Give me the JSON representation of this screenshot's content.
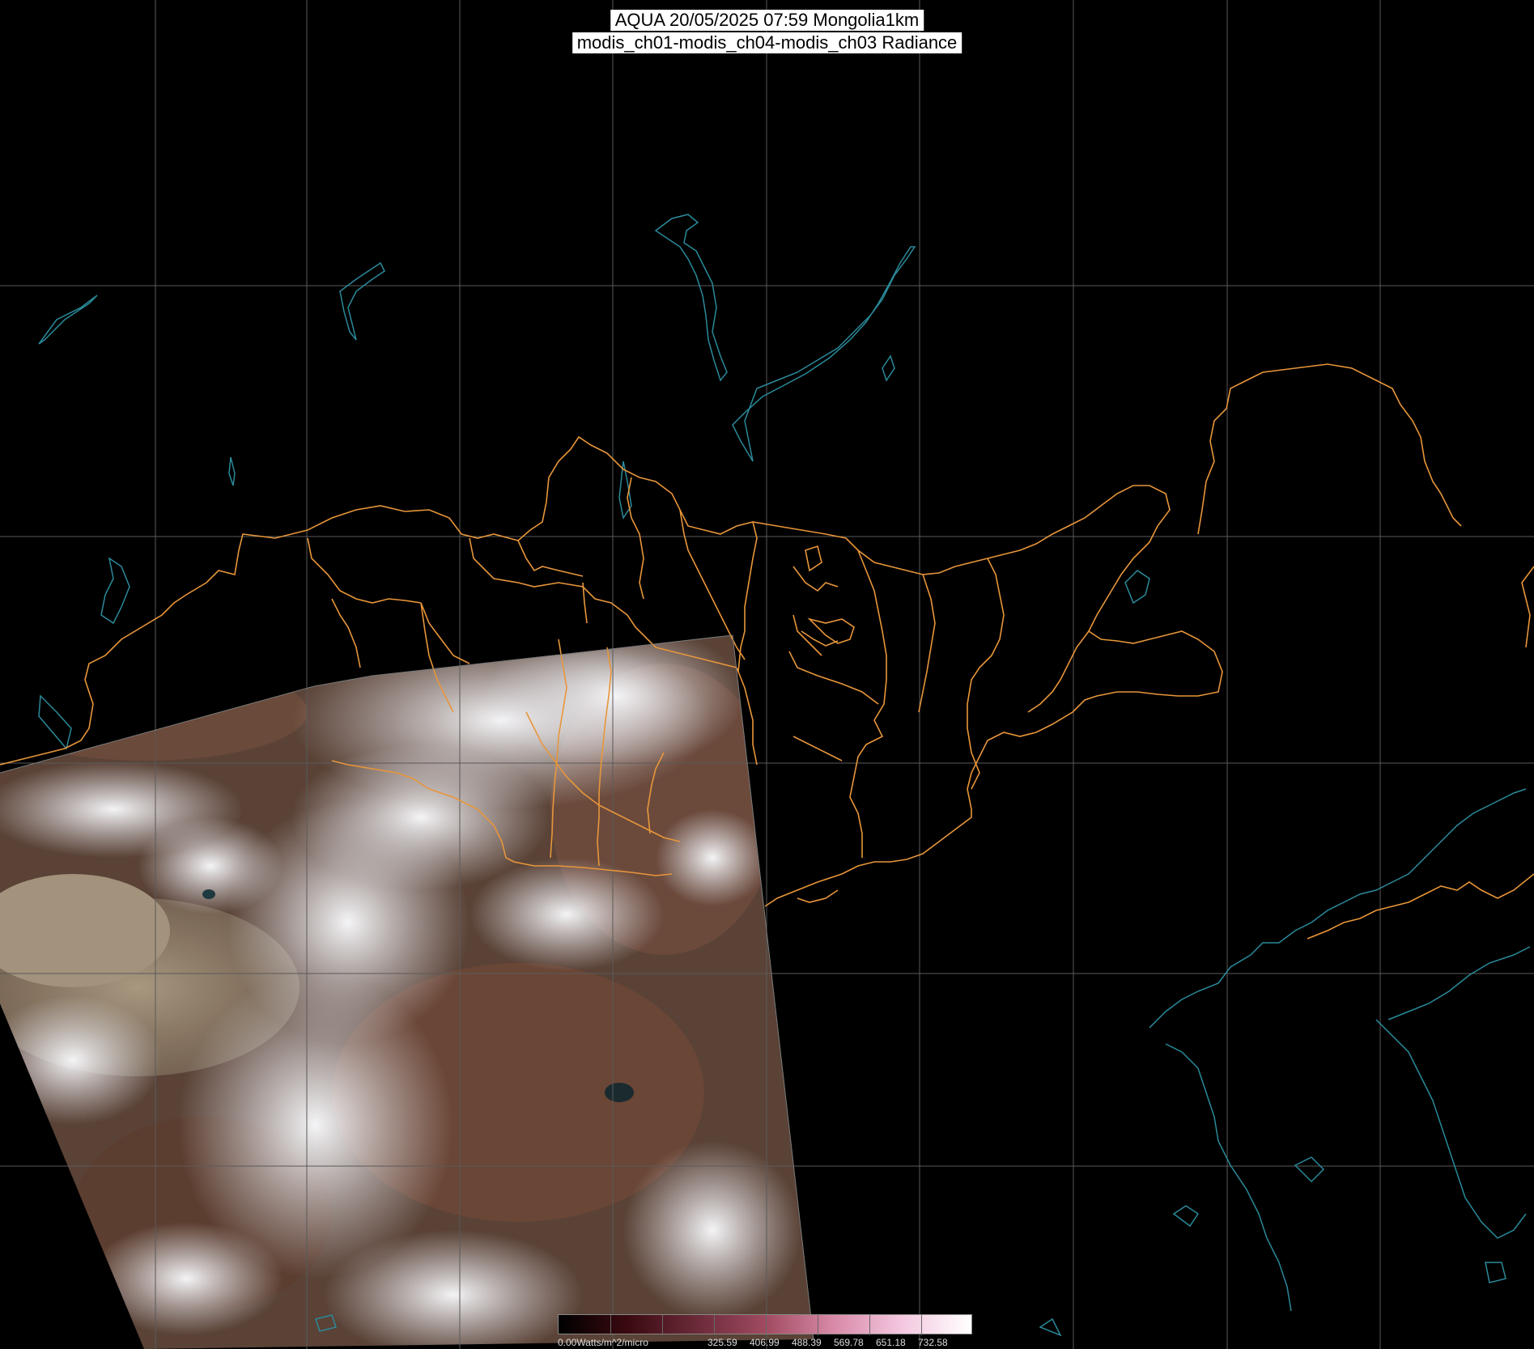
{
  "title": {
    "line1": "AQUA 20/05/2025 07:59 Mongolia1km",
    "line2": "modis_ch01-modis_ch04-modis_ch03 Radiance"
  },
  "map": {
    "background": "#000000",
    "grid_color": "#5a5a5a",
    "border_color": "#e8963a",
    "coast_color": "#2a8a9a"
  },
  "colorbar": {
    "labels": [
      "0.00Watts/m^2/micro",
      "325.59",
      "406.99",
      "488.39",
      "569.78",
      "651.18",
      "732.58"
    ],
    "colors": [
      "#000000",
      "#3a0a10",
      "#6a2a38",
      "#a04a60",
      "#d88aa8",
      "#f4c8e0",
      "#ffffff"
    ]
  }
}
